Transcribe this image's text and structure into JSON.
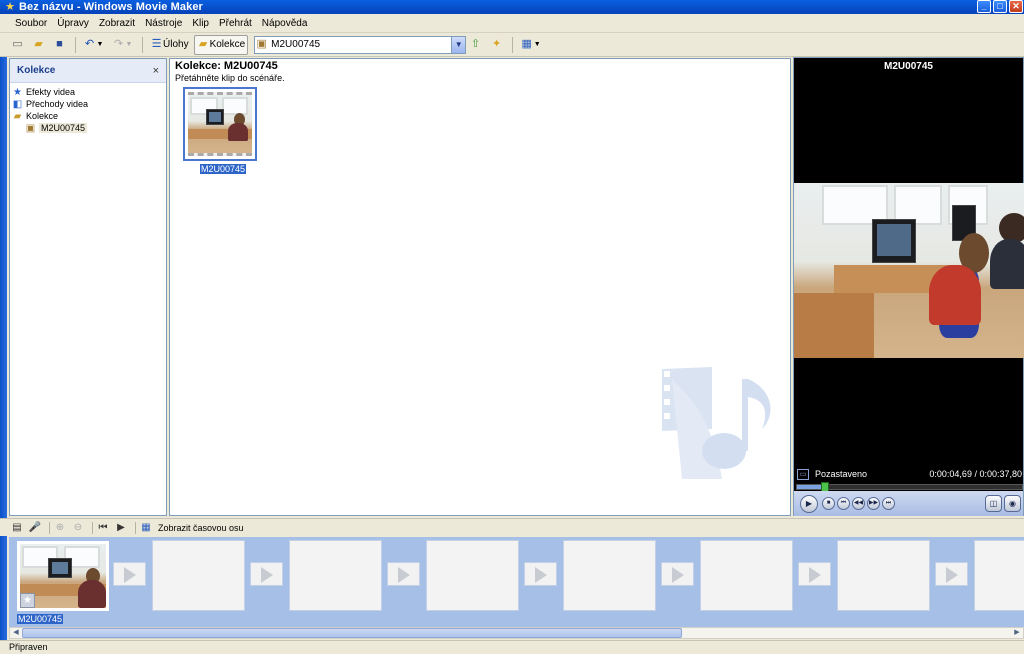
{
  "window": {
    "title": "Bez názvu - Windows Movie Maker",
    "app_icon": "movie-maker-star-icon",
    "controls": {
      "minimize": "minimize-icon",
      "maximize": "maximize-icon",
      "close": "close-icon"
    }
  },
  "menu": [
    "Soubor",
    "Úpravy",
    "Zobrazit",
    "Nástroje",
    "Klip",
    "Přehrát",
    "Nápověda"
  ],
  "toolbar": {
    "tasks_label": "Úlohy",
    "collections_label": "Kolekce",
    "collection_combo_value": "M2U00745"
  },
  "left_panel": {
    "title": "Kolekce",
    "close_glyph": "×",
    "tree": [
      {
        "label": "Efekty videa",
        "icon": "star-effects-icon"
      },
      {
        "label": "Přechody videa",
        "icon": "transitions-icon"
      },
      {
        "label": "Kolekce",
        "icon": "collection-folder-icon"
      },
      {
        "label": "M2U00745",
        "icon": "collection-item-icon"
      }
    ]
  },
  "collection": {
    "title": "Kolekce: M2U00745",
    "subtitle": "Přetáhněte klip do scénáře.",
    "clip_label": "M2U00745"
  },
  "preview": {
    "title": "M2U00745",
    "status": "Pozastaveno",
    "time": "0:00:04,69 / 0:00:37,80",
    "progress_fraction": 0.124
  },
  "storyboard_toolbar": {
    "show_timeline_label": "Zobrazit časovou osu"
  },
  "storyboard": {
    "first_clip_label": "M2U00745",
    "empty_slot_count": 7
  },
  "statusbar": {
    "text": "Připraven"
  },
  "colors": {
    "title_bar": "#0a5fe0",
    "panel_border": "#7f9db9",
    "storyboard_bg": "#a6bfe6",
    "selection": "#2d64c8"
  }
}
